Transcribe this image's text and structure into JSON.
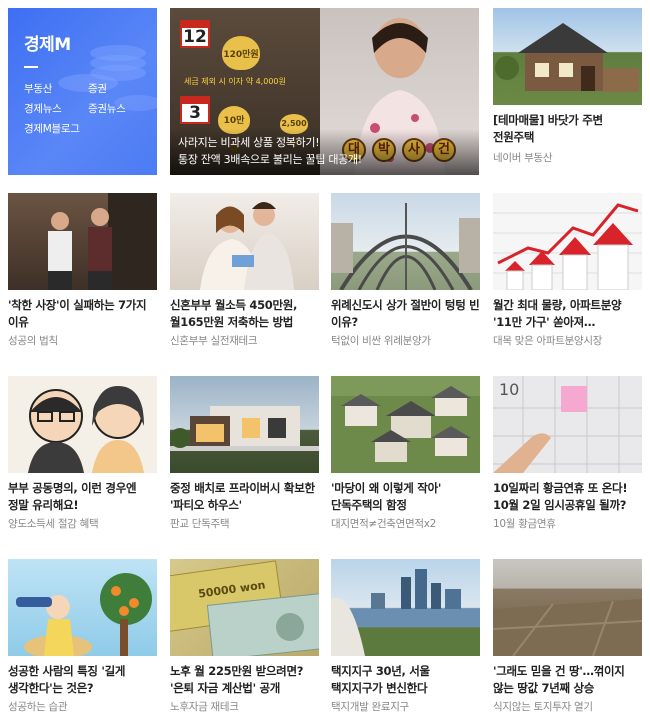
{
  "menu": {
    "title": "경제M",
    "links": [
      "부동산",
      "증권",
      "경제뉴스",
      "증권뉴스",
      "경제M블로그"
    ]
  },
  "feature": {
    "caption_line1": "사라지는 비과세 상품 정복하기!",
    "caption_line2": "통장 잔액 3배속으로 불리는 꿀팁 대공개!",
    "calendar_top": "12",
    "calendar_bottom": "3",
    "coin_top": "120만원",
    "coin_bottom": "10만 원",
    "coin_small": "2,500원",
    "overlay_text": "세금 제외 시 이자 약 4,000원",
    "drama_chars": [
      "대",
      "박",
      "사",
      "건"
    ]
  },
  "tiles": [
    {
      "title": "[테마매물] 바닷가 주변 전원주택",
      "source": "네이버 부동산"
    },
    {
      "title": "'착한 사장'이 실패하는 7가지 이유",
      "source": "성공의 법칙"
    },
    {
      "title": "신혼부부 월소득 450만원, 월165만원 저축하는 방법",
      "source": "신혼부부 실전재테크"
    },
    {
      "title": "위례신도시 상가 절반이 텅텅 빈 이유?",
      "source": "턱없이 비싼 위례분양가"
    },
    {
      "title": "월간 최대 물량, 아파트분양 '11만 가구' 쏟아져…",
      "source": "대목 맞은 아파트분양시장"
    },
    {
      "title": "부부 공동명의, 이런 경우엔 정말 유리해요!",
      "source": "양도소득세 절감 혜택"
    },
    {
      "title": "중정 배치로 프라이버시 확보한 '파티오 하우스'",
      "source": "판교 단독주택"
    },
    {
      "title": "'마당이 왜 이렇게 작아' 단독주택의 함정",
      "source": "대지면적≠건축연면적x2"
    },
    {
      "title": "10일짜리 황금연휴 또 온다! 10월 2일 임시공휴일 될까?",
      "source": "10월 황금연휴"
    },
    {
      "title": "성공한 사람의 특징 '길게 생각한다'는 것은?",
      "source": "성공하는 습관"
    },
    {
      "title": "노후 월 225만원 받으려면? '은퇴 자금 계산법' 공개",
      "source": "노후자금 재테크"
    },
    {
      "title": "택지지구 30년, 서울 택지지구가 변신한다",
      "source": "택지개발 완료지구"
    },
    {
      "title": "'그래도 믿을 건 땅'…꺾이지 않는 땅값 7년째 상승",
      "source": "식지않는 토지투자 열기"
    }
  ],
  "banknote_text": "50000 won",
  "calendar_thumb_number": "10",
  "colors": {
    "menu_blue": "#3d6ff2",
    "title": "#222222",
    "source": "#888888"
  }
}
